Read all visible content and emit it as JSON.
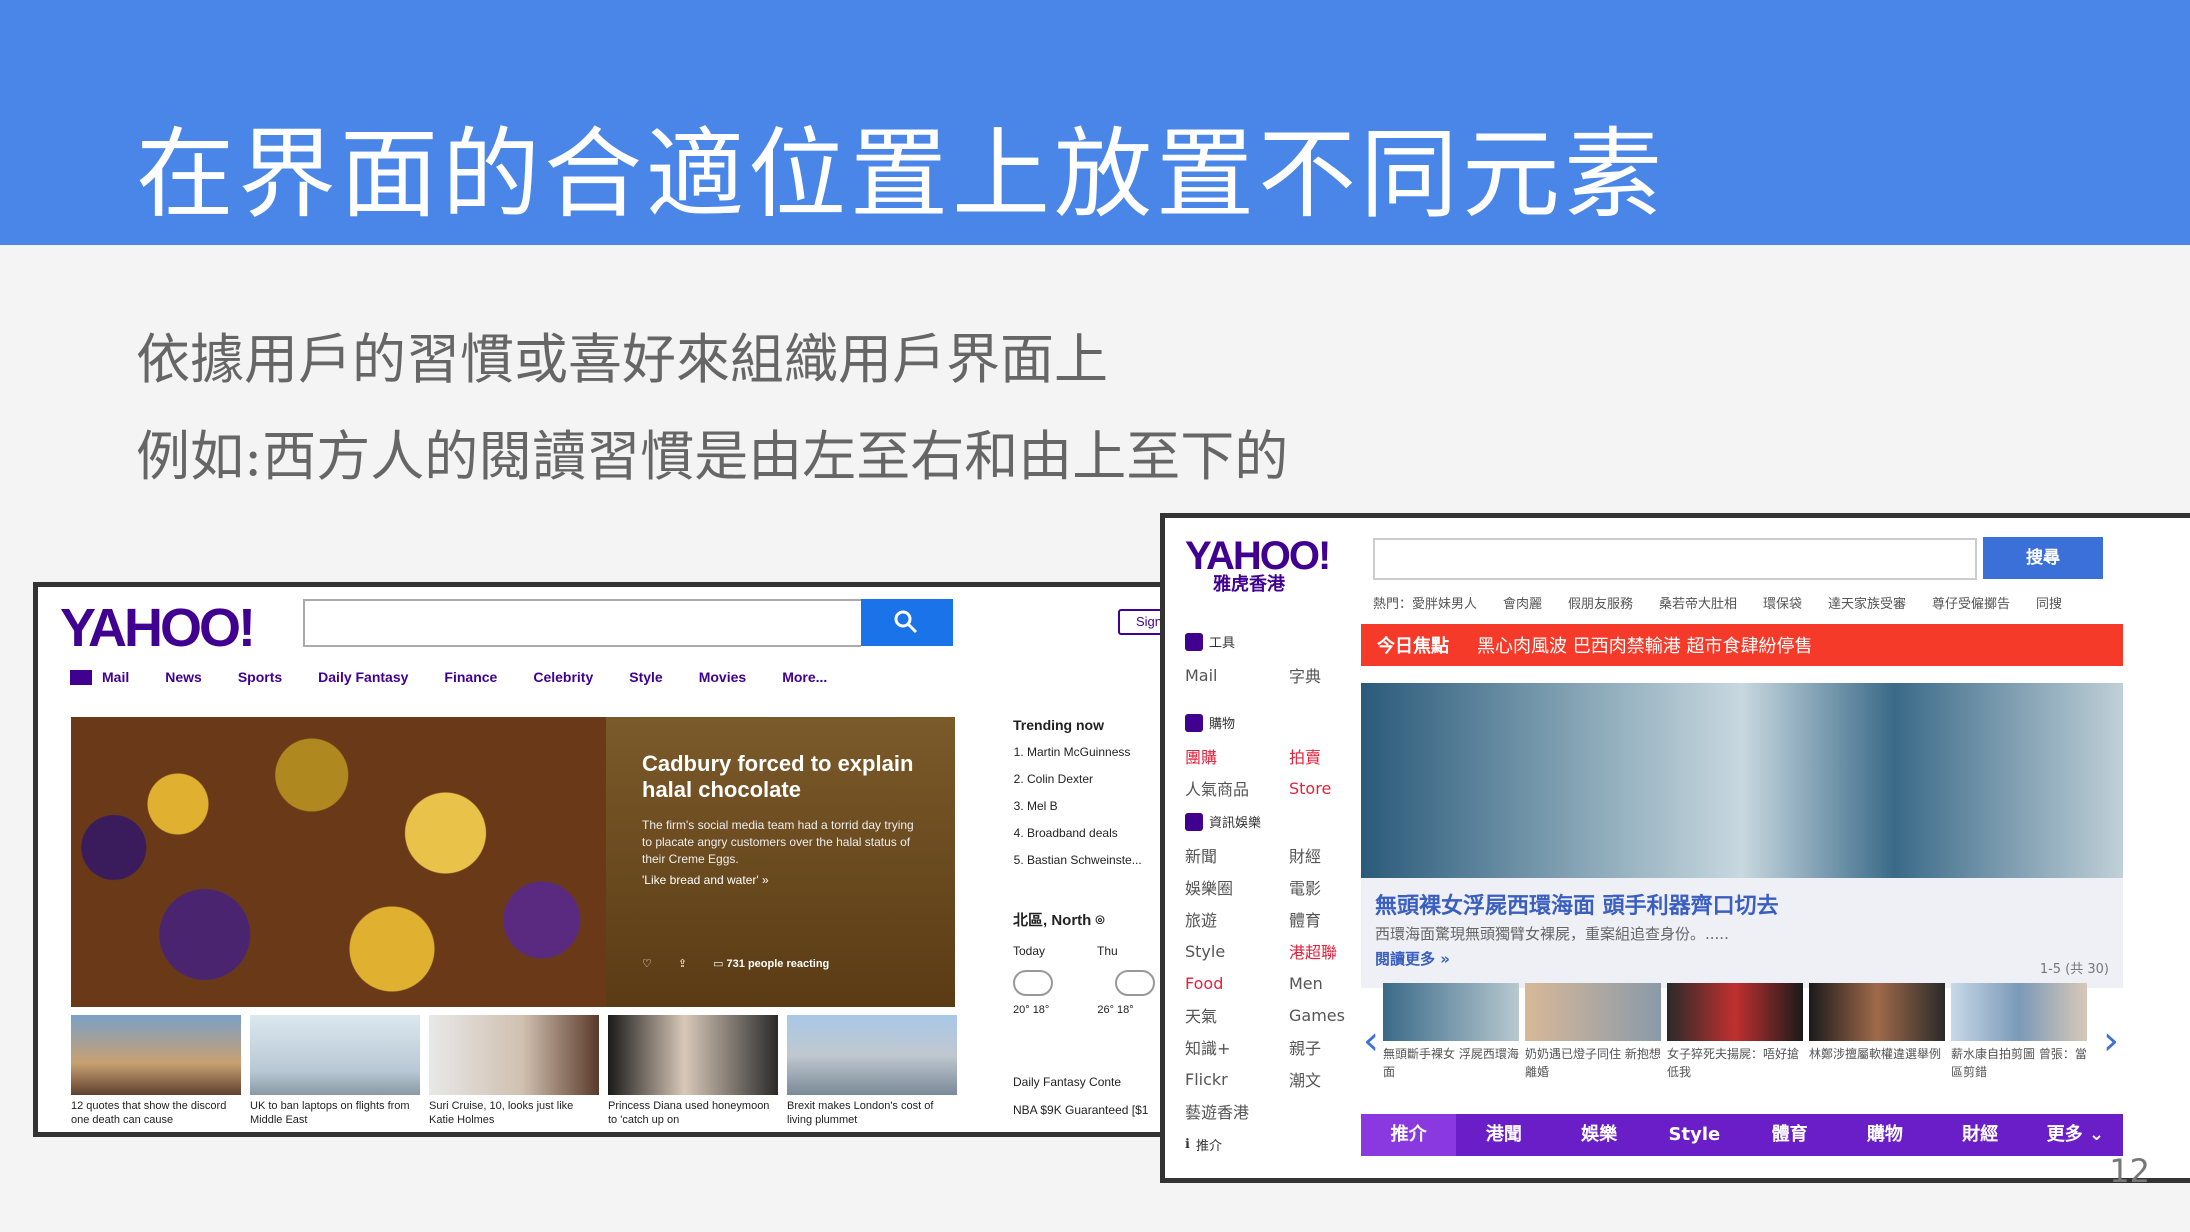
{
  "slide": {
    "title": "在界面的合適位置上放置不同元素",
    "bullets": [
      "依據用戶的習慣或喜好來組織用戶界面上",
      "例如:西方人的閱讀習慣是由左至右和由上至下的"
    ],
    "page_number": "12"
  },
  "yahoo_us": {
    "logo": "YAHOO!",
    "signin": "Sign",
    "nav": [
      "Mail",
      "News",
      "Sports",
      "Daily Fantasy",
      "Finance",
      "Celebrity",
      "Style",
      "Movies",
      "More..."
    ],
    "hero": {
      "title": "Cadbury forced to explain halal chocolate",
      "desc": "The firm's social media team had a torrid day trying to placate angry customers over the halal status of their Creme Eggs.",
      "link": "'Like bread and water' »",
      "reactions": "731 people reacting"
    },
    "thumbs": [
      {
        "caption": "12 quotes that show the discord one death can cause"
      },
      {
        "caption": "UK to ban laptops on flights from Middle East"
      },
      {
        "caption": "Suri Cruise, 10, looks just like Katie Holmes"
      },
      {
        "caption": "Princess Diana used honeymoon to 'catch up on"
      },
      {
        "caption": "Brexit makes London's cost of living plummet"
      }
    ],
    "trending": {
      "title": "Trending now",
      "items": [
        "Martin McGuinness",
        "Colin Dexter",
        "Mel B",
        "Broadband deals",
        "Bastian Schweinste..."
      ]
    },
    "weather": {
      "location": "北區, North",
      "days": [
        "Today",
        "Thu"
      ],
      "temps": [
        "20° 18°",
        "26° 18°"
      ]
    },
    "fantasy": [
      "Daily Fantasy Conte",
      "NBA $9K Guaranteed [$1"
    ]
  },
  "yahoo_hk": {
    "logo": "YAHOO!",
    "logo_sub": "雅虎香港",
    "search_button": "搜尋",
    "hot": "熱門：愛胖妹男人　　會肉麗　　假朋友服務　　桑若帝大肚相　　環保袋　　達天家族受審　　尊仔受僱擲告　　同搜",
    "side": {
      "tools": "工具",
      "tools_items": [
        "Mail",
        "字典"
      ],
      "shopping": "購物",
      "shopping_items": [
        [
          "團購",
          "拍賣"
        ],
        [
          "人氣商品",
          "Store"
        ]
      ],
      "info": "資訊娛樂",
      "info_items": [
        [
          "新聞",
          "財經"
        ],
        [
          "娛樂圈",
          "電影"
        ],
        [
          "旅遊",
          "體育"
        ],
        [
          "Style",
          "港超聯"
        ],
        [
          "Food",
          "Men"
        ],
        [
          "天氣",
          "Games"
        ],
        [
          "知識+",
          "親子"
        ],
        [
          "Flickr",
          "潮文"
        ],
        [
          "藝遊香港",
          ""
        ]
      ],
      "recommend": "推介"
    },
    "focus_label": "今日焦點",
    "focus_text": "黑心肉風波 巴西肉禁輸港 超市食肆紛停售",
    "headline": "無頭裸女浮屍西環海面 頭手利器齊口切去",
    "desc": "西環海面驚現無頭獨臂女裸屍，重案組追查身份。.....",
    "more": "閱讀更多 »",
    "count": "1-5 (共 30)",
    "thumbs": [
      "無頭斷手裸女 浮屍西環海面",
      "奶奶遇已燈子同住 新抱想離婚",
      "女子猝死夫揚屍：唔好搶低我",
      "林鄭涉擅屬軟權違選舉例",
      "薪水康自拍剪圖 曾張：當區剪錯"
    ],
    "tabs": [
      "推介",
      "港聞",
      "娛樂",
      "Style",
      "體育",
      "購物",
      "財經",
      "更多 ⌄"
    ]
  }
}
